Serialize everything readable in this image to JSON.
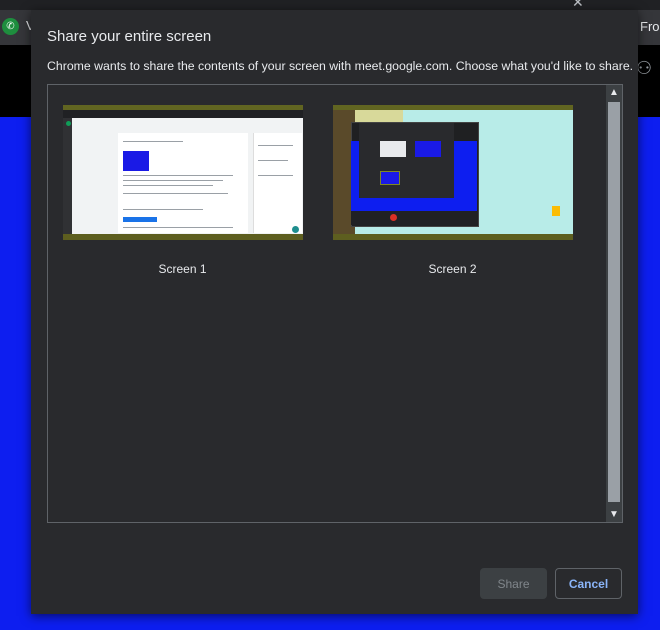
{
  "background": {
    "left_letter": "V",
    "right_text": "Fro"
  },
  "dialog": {
    "title": "Share your entire screen",
    "description": "Chrome wants to share the contents of your screen with meet.google.com. Choose what you'd like to share.",
    "sources": [
      {
        "label": "Screen 1"
      },
      {
        "label": "Screen 2"
      }
    ],
    "share_label": "Share",
    "cancel_label": "Cancel"
  },
  "colors": {
    "dialog_bg": "#292a2d",
    "accent": "#8ab4f8",
    "page_blue": "#0d1ef0"
  }
}
